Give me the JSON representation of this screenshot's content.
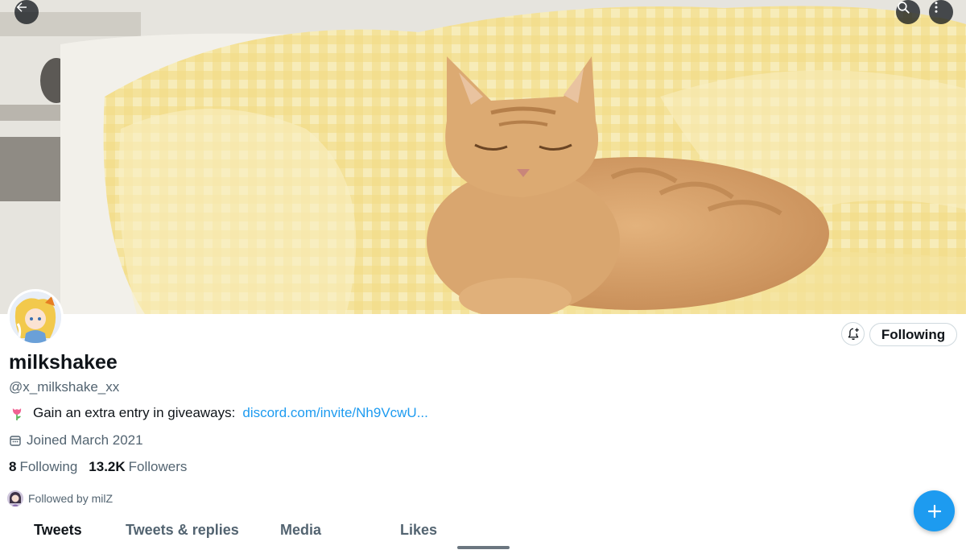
{
  "header": {
    "back_icon": "arrow-left-icon",
    "search_icon": "search-icon",
    "more_icon": "more-vertical-icon"
  },
  "profile": {
    "display_name": "milkshakee",
    "handle": "@x_milkshake_xx",
    "bio_emoji": "tulip-icon",
    "bio_text": "Gain an extra entry in giveaways:",
    "bio_link": "discord.com/invite/Nh9VcwU...",
    "joined": "Joined March 2021",
    "following_count": "8",
    "following_label": "Following",
    "followers_count": "13.2K",
    "followers_label": "Followers",
    "followed_by": "Followed by milZ"
  },
  "actions": {
    "notify_icon": "bell-plus-icon",
    "following_button": "Following"
  },
  "tabs": [
    {
      "label": "Tweets",
      "active": true
    },
    {
      "label": "Tweets & replies",
      "active": false
    },
    {
      "label": "Media",
      "active": false
    },
    {
      "label": "Likes",
      "active": false
    }
  ],
  "fab": {
    "icon": "plus-icon"
  },
  "colors": {
    "accent": "#1d9bf0",
    "text_primary": "#0f1419",
    "text_secondary": "#536471"
  }
}
